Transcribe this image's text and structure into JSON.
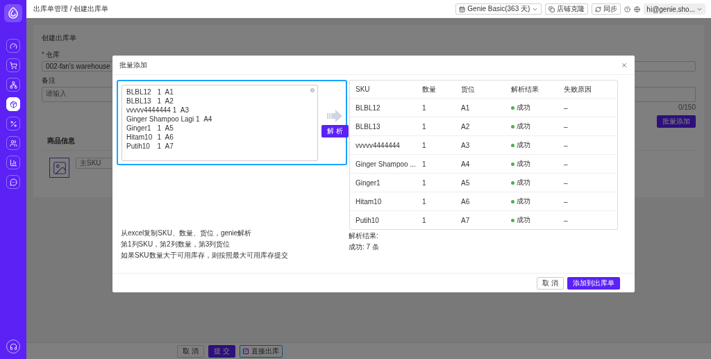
{
  "header": {
    "breadcrumb": "出库单管理 / 创建出库单",
    "plan": "Genie Basic(363 天)",
    "clone_button": "店铺克隆",
    "sync_button": "同步",
    "user": "hi@genie.sho..."
  },
  "sidebar": {
    "items": [
      {
        "selected": false
      },
      {
        "selected": false
      },
      {
        "selected": false
      },
      {
        "selected": true
      },
      {
        "selected": false
      },
      {
        "selected": false
      },
      {
        "selected": false
      },
      {
        "selected": false
      }
    ]
  },
  "page": {
    "title": "创建出库单",
    "fields": [
      {
        "label": "仓库",
        "required_mark": "*",
        "value": "002-fan's warehouse"
      }
    ],
    "remark": {
      "label": "备注",
      "placeholder": "请输入",
      "counter": "0/150"
    },
    "batch_add_button": "批量添加",
    "product_section": {
      "title": "商品信息",
      "sku_placeholder": "主SKU"
    },
    "footer": {
      "cancel": "取 消",
      "submit": "提 交",
      "direct": {
        "label": "直接出库",
        "checked": true
      }
    }
  },
  "modal": {
    "title": "批量添加",
    "input_lines": [
      "BLBL12\t1\tA1",
      "BLBL13\t1\tA2",
      "vvvvv4444444\t1\tA3",
      "Ginger Shampoo Lagi\t1\tA4",
      "Ginger1\t1\tA5",
      "Hitam10\t1\tA6",
      "Putih10\t1\tA7"
    ],
    "parse_button": "解 析",
    "table": {
      "columns": [
        "SKU",
        "数量",
        "货位",
        "解析结果",
        "失败原因"
      ],
      "rows": [
        {
          "sku": "BLBL12",
          "qty": "1",
          "location": "A1",
          "result": "成功",
          "reason": "–"
        },
        {
          "sku": "BLBL13",
          "qty": "1",
          "location": "A2",
          "result": "成功",
          "reason": "–"
        },
        {
          "sku": "vvvvv4444444",
          "qty": "1",
          "location": "A3",
          "result": "成功",
          "reason": "–"
        },
        {
          "sku": "Ginger Shampoo ...",
          "qty": "1",
          "location": "A4",
          "result": "成功",
          "reason": "–"
        },
        {
          "sku": "Ginger1",
          "qty": "1",
          "location": "A5",
          "result": "成功",
          "reason": "–"
        },
        {
          "sku": "Hitam10",
          "qty": "1",
          "location": "A6",
          "result": "成功",
          "reason": "–"
        },
        {
          "sku": "Putih10",
          "qty": "1",
          "location": "A7",
          "result": "成功",
          "reason": "–"
        }
      ]
    },
    "hints": [
      "从excel复制SKU、数量、货位，genie解析",
      "第1列SKU，第2列数量，第3列货位",
      "如果SKU数量大于可用库存，则按照最大可用库存提交"
    ],
    "result_title": "解析结果:",
    "result_summary": "成功: 7 条",
    "cancel_button": "取 消",
    "confirm_button": "添加到出库单"
  }
}
